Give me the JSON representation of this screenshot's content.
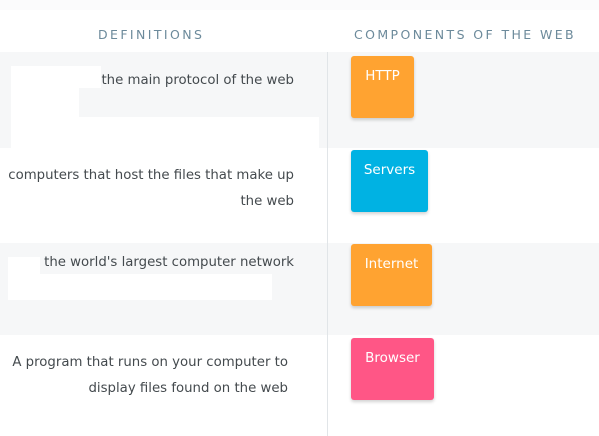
{
  "headers": {
    "definitions": "DEFINITIONS",
    "components": "COMPONENTS OF THE WEB"
  },
  "definitions": [
    {
      "text": "the main protocol of the web"
    },
    {
      "text": "computers that host the files that make up the web"
    },
    {
      "text": "the world's largest computer network"
    },
    {
      "text": "A program that runs on your computer to display files found on the web"
    }
  ],
  "components": [
    {
      "label": "HTTP",
      "color": "#ffa331"
    },
    {
      "label": "Servers",
      "color": "#00b2e3"
    },
    {
      "label": "Internet",
      "color": "#ffa331"
    },
    {
      "label": "Browser",
      "color": "#ff5686"
    }
  ]
}
